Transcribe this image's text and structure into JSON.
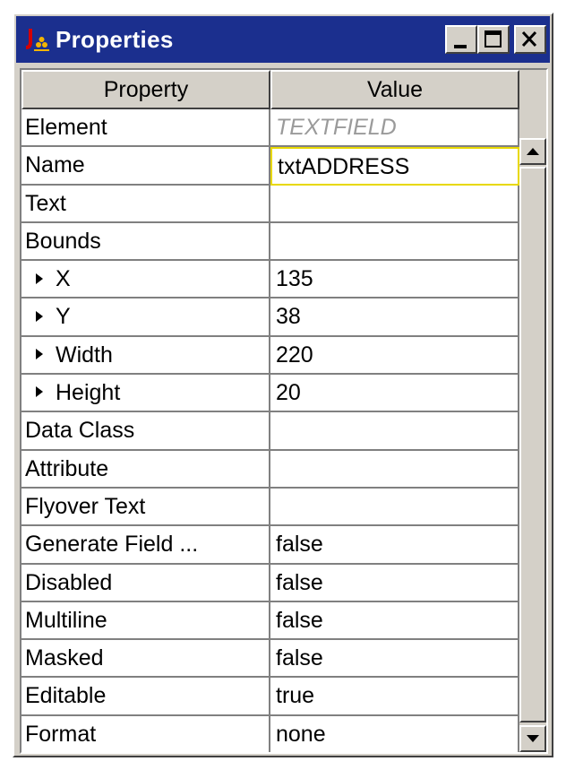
{
  "window": {
    "title": "Properties",
    "buttons": [
      "minimize",
      "maximize",
      "close"
    ]
  },
  "table": {
    "columns": [
      "Property",
      "Value"
    ],
    "rows": [
      {
        "property": "Element",
        "value": "TEXTFIELD"
      },
      {
        "property": "Name",
        "value": "txtADDRESS"
      },
      {
        "property": "Text",
        "value": ""
      },
      {
        "property": "Bounds",
        "value": ""
      },
      {
        "property": "X",
        "value": "135"
      },
      {
        "property": "Y",
        "value": "38"
      },
      {
        "property": "Width",
        "value": "220"
      },
      {
        "property": "Height",
        "value": "20"
      },
      {
        "property": "Data Class",
        "value": ""
      },
      {
        "property": "Attribute",
        "value": ""
      },
      {
        "property": "Flyover Text",
        "value": ""
      },
      {
        "property": "Generate Field ...",
        "value": "false"
      },
      {
        "property": "Disabled",
        "value": "false"
      },
      {
        "property": "Multiline",
        "value": "false"
      },
      {
        "property": "Masked",
        "value": "false"
      },
      {
        "property": "Editable",
        "value": "true"
      },
      {
        "property": "Format",
        "value": "none"
      }
    ]
  },
  "colors": {
    "titlebar": "#1b2f8e",
    "selection_border": "#e8d800",
    "placeholder_text": "#9a9a9a"
  },
  "icons": {
    "app": "java-icon",
    "expand": "triangle-right-icon",
    "scroll_up": "arrow-up-icon",
    "scroll_down": "arrow-down-icon"
  }
}
